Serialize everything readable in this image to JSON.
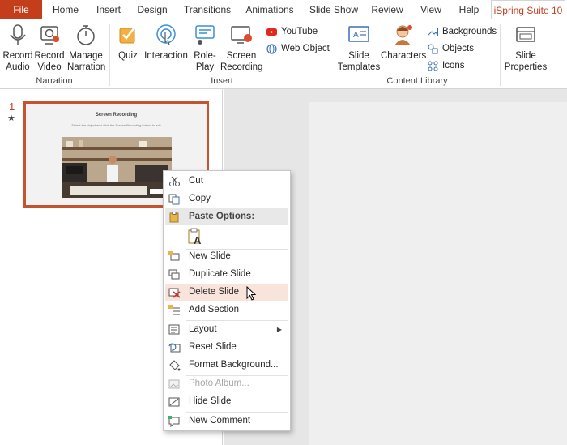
{
  "tabs": [
    "File",
    "Home",
    "Insert",
    "Design",
    "Transitions",
    "Animations",
    "Slide Show",
    "Review",
    "View",
    "Help",
    "iSpring Suite 10"
  ],
  "ribbon": {
    "narration": {
      "record_audio": "Record\nAudio",
      "record_video": "Record\nVideo",
      "manage_narration": "Manage\nNarration",
      "group_label": "Narration"
    },
    "insert": {
      "quiz": "Quiz",
      "interaction": "Interaction",
      "role_play": "Role-\nPlay",
      "screen_recording": "Screen\nRecording",
      "youtube": "YouTube",
      "web_object": "Web Object",
      "group_label": "Insert"
    },
    "content_library": {
      "slide_templates": "Slide\nTemplates",
      "characters": "Characters",
      "backgrounds": "Backgrounds",
      "objects": "Objects",
      "icons": "Icons",
      "group_label": "Content Library"
    },
    "slide_properties": "Slide\nProperties"
  },
  "slide_panel": {
    "slide_number": "1",
    "star": "★",
    "thumbnail_title": "Screen Recording",
    "thumbnail_subtitle": "Select the object and click the Screen Recording button to edit"
  },
  "context_menu": {
    "cut": "Cut",
    "copy": "Copy",
    "paste_options": "Paste Options:",
    "new_slide": "New Slide",
    "duplicate_slide": "Duplicate Slide",
    "delete_slide": "Delete Slide",
    "add_section": "Add Section",
    "layout": "Layout",
    "reset_slide": "Reset Slide",
    "format_background": "Format Background...",
    "photo_album": "Photo Album...",
    "hide_slide": "Hide Slide",
    "new_comment": "New Comment"
  },
  "colors": {
    "accent": "#c43e1c",
    "hover": "#f9e4dc",
    "thumb_border": "#c4542f"
  }
}
